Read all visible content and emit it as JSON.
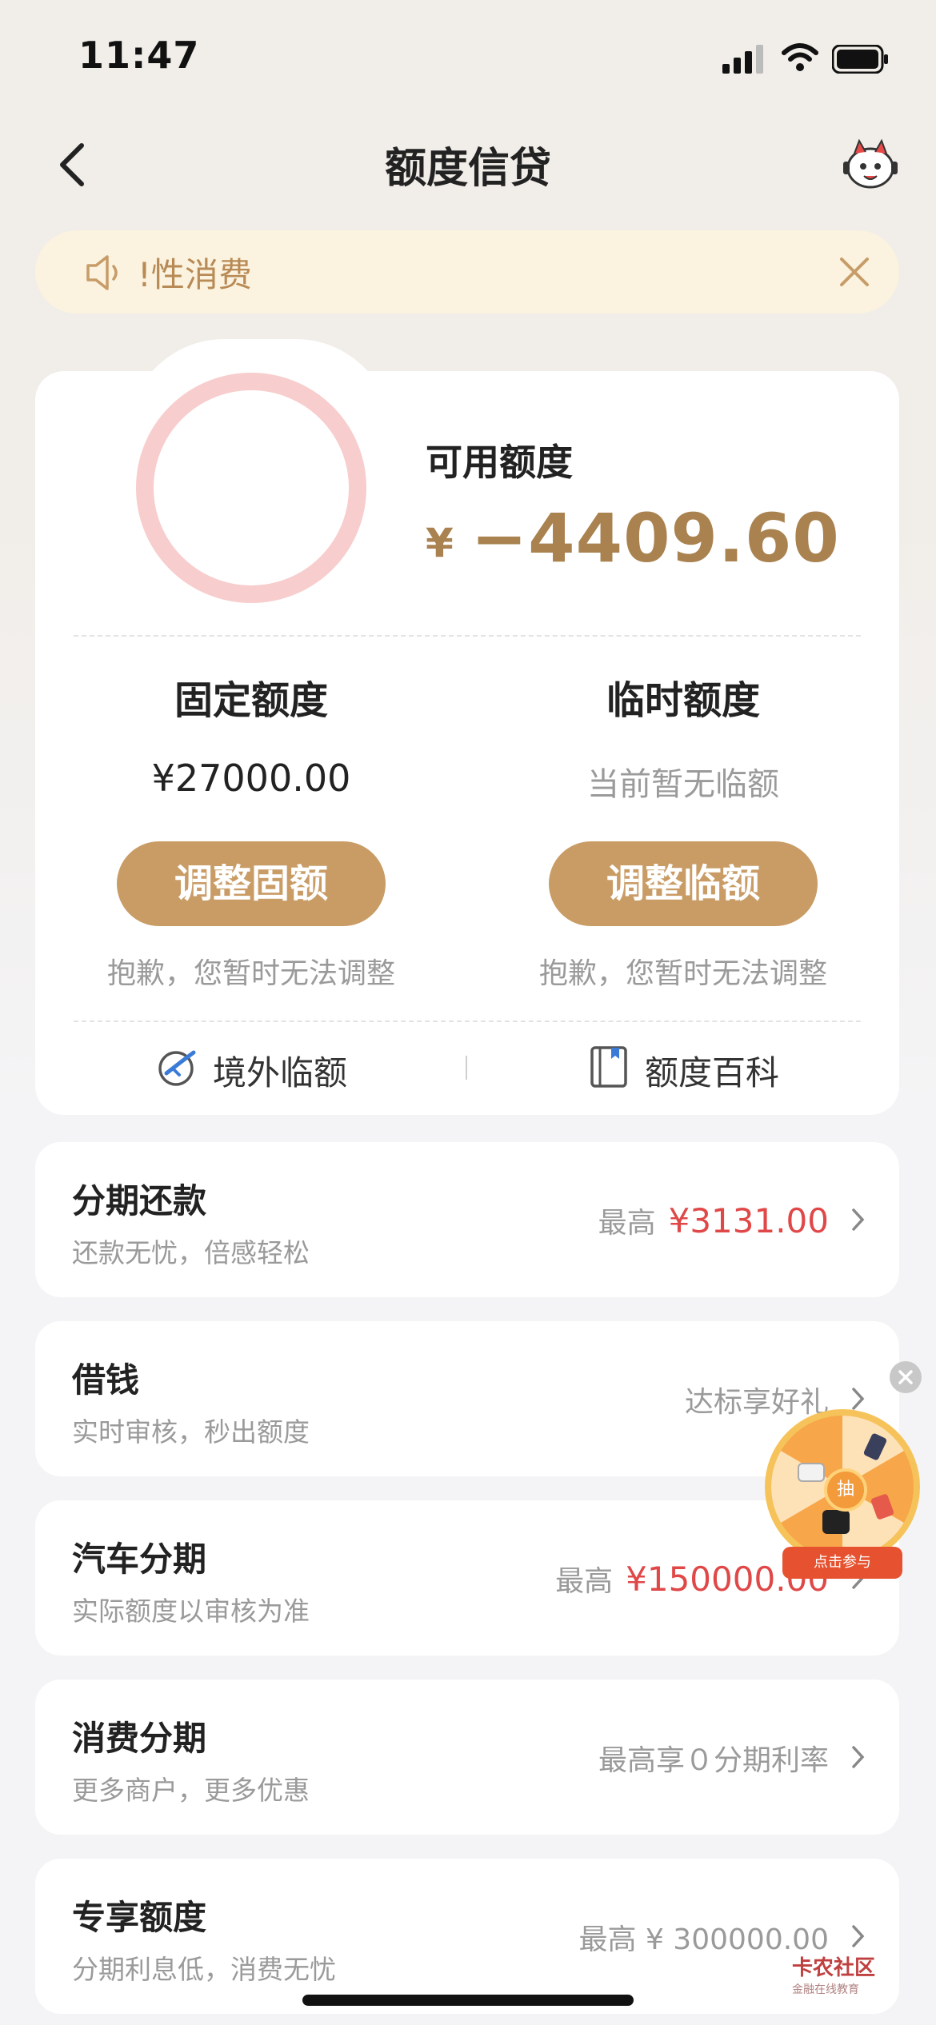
{
  "status_bar": {
    "time": "11:47"
  },
  "nav": {
    "title": "额度信贷"
  },
  "notice": {
    "text": "!性消费"
  },
  "quota": {
    "available_label": "可用额度",
    "available_currency": "¥",
    "available_amount": "−4409.60",
    "fixed": {
      "title": "固定额度",
      "value": "¥27000.00",
      "button": "调整固额",
      "note": "抱歉，您暂时无法调整"
    },
    "temporary": {
      "title": "临时额度",
      "value": "当前暂无临额",
      "button": "调整临额",
      "note": "抱歉，您暂时无法调整"
    },
    "links": {
      "overseas": "境外临额",
      "encyclopedia": "额度百科"
    }
  },
  "rows": [
    {
      "title": "分期还款",
      "subtitle": "还款无忧，倍感轻松",
      "right_label": "最高",
      "right_value": "¥3131.00"
    },
    {
      "title": "借钱",
      "subtitle": "实时审核，秒出额度",
      "right_label": "达标享好礼",
      "right_value": ""
    },
    {
      "title": "汽车分期",
      "subtitle": "实际额度以审核为准",
      "right_label": "最高",
      "right_value": "¥150000.00"
    },
    {
      "title": "消费分期",
      "subtitle": "更多商户，更多优惠",
      "right_label": "最高享０分期利率",
      "right_value": ""
    },
    {
      "title": "专享额度",
      "subtitle": "分期利息低，消费无忧",
      "right_label": "最高 ¥ 300000.00",
      "right_value": ""
    }
  ],
  "floating": {
    "center": "抽",
    "tag": "点击参与"
  },
  "watermark": {
    "name": "卡农社区",
    "slogan": "金融在线教育"
  },
  "colors": {
    "accent": "#c99c66",
    "amount": "#a9824f",
    "red": "#e04848",
    "ring": "#f8cdcd"
  }
}
